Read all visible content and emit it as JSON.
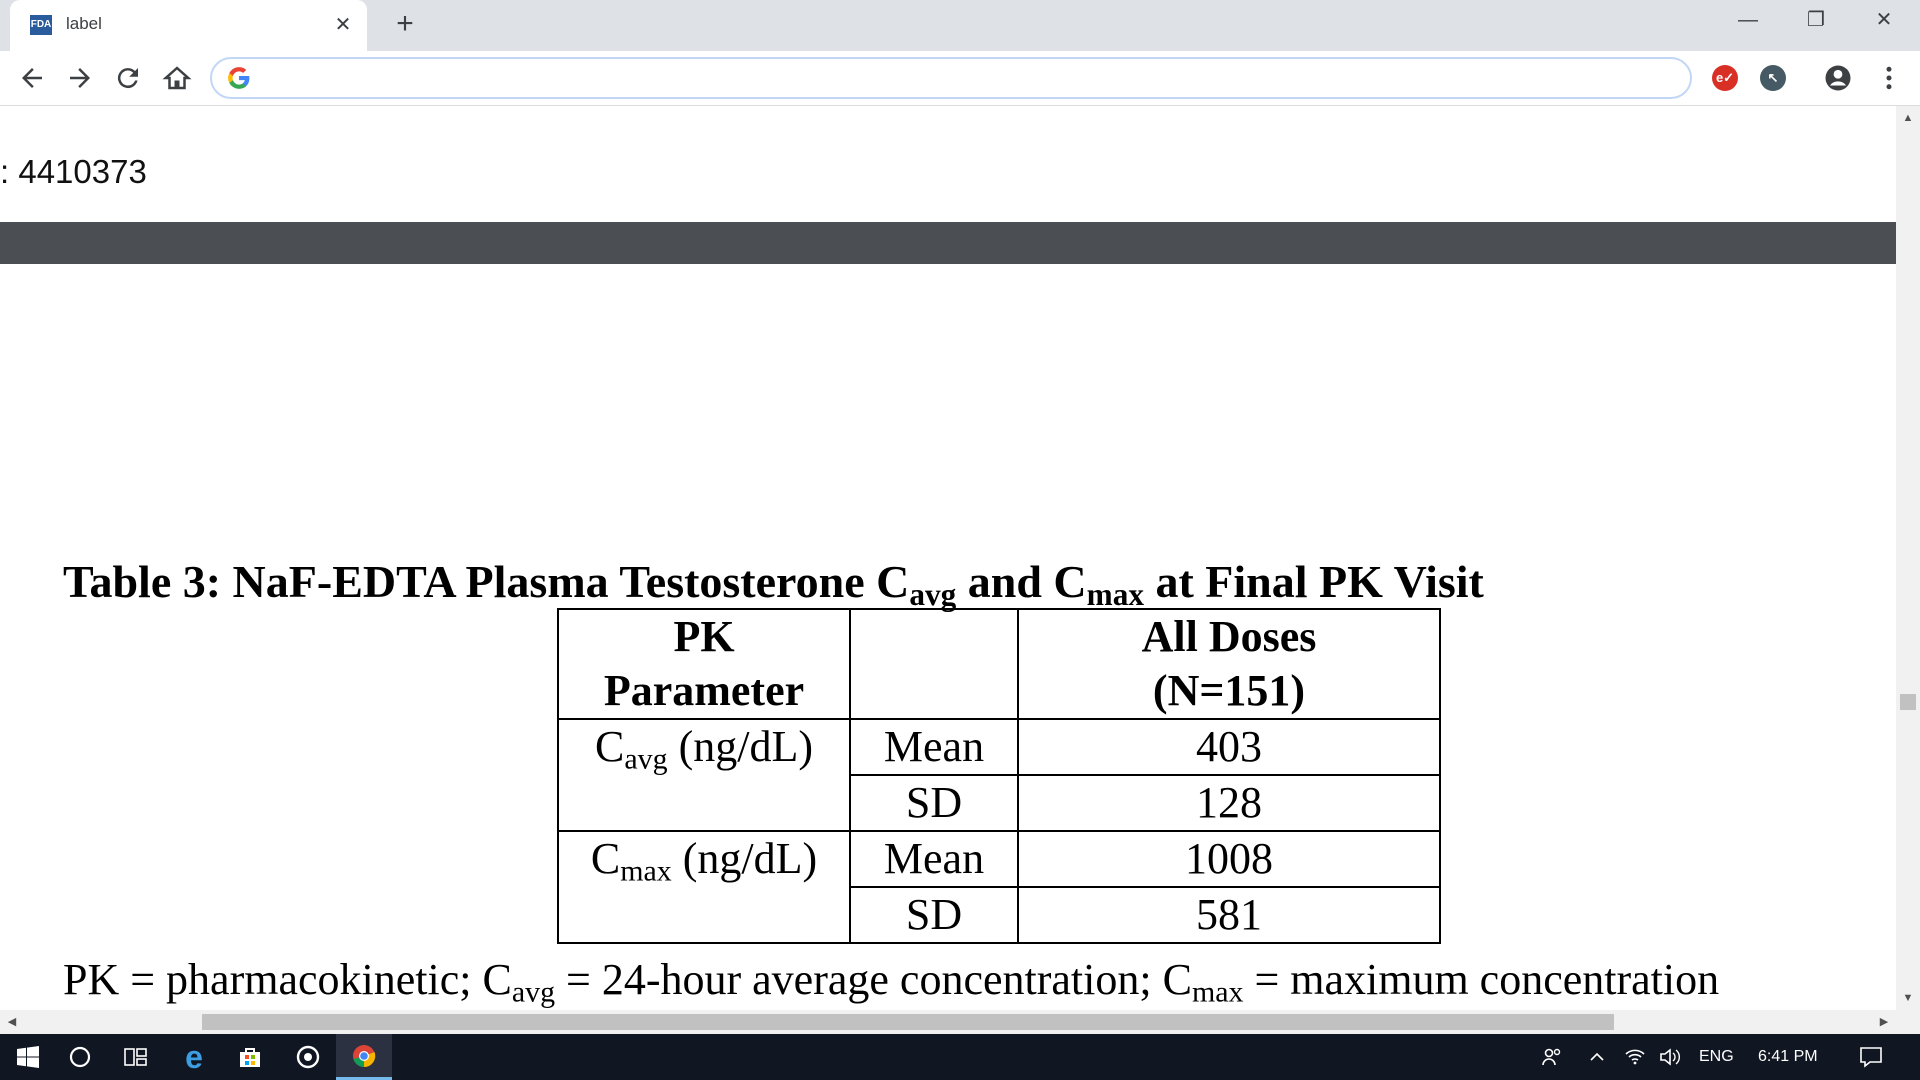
{
  "browser": {
    "tab": {
      "favicon_text": "FDA",
      "title": "label",
      "close_glyph": "✕"
    },
    "new_tab_glyph": "+",
    "window_controls": {
      "minimize": "—",
      "restore": "❐",
      "close": "✕"
    },
    "address_bar": {
      "value": "",
      "placeholder": ""
    },
    "icons": [
      "back-icon",
      "forward-icon",
      "reload-icon",
      "home-icon",
      "google-icon",
      "extension-red-icon",
      "extension-cursor-icon",
      "profile-icon",
      "menu-icon"
    ],
    "extension_red": {
      "glyph": "e✓",
      "color": "#d93025"
    },
    "extension_dark": {
      "glyph": "↖",
      "color": "#455a64"
    }
  },
  "page": {
    "setid_text": ": 4410373",
    "table_caption": {
      "prefix": "Table 3: NaF-EDTA Plasma Testosterone C",
      "sub1": "avg",
      "mid": " and C",
      "sub2": "max",
      "suffix": " at Final PK Visit"
    },
    "table": {
      "header": {
        "col1_line1": "PK",
        "col1_line2": "Parameter",
        "col2": "",
        "col3_line1": "All Doses",
        "col3_line2": "(N=151)"
      },
      "groups": [
        {
          "param_base": "C",
          "param_sub": "avg",
          "param_unit": " (ng/dL)",
          "rows": [
            {
              "stat": "Mean",
              "value": "403"
            },
            {
              "stat": "SD",
              "value": "128"
            }
          ]
        },
        {
          "param_base": "C",
          "param_sub": "max",
          "param_unit": " (ng/dL)",
          "rows": [
            {
              "stat": "Mean",
              "value": "1008"
            },
            {
              "stat": "SD",
              "value": "581"
            }
          ]
        }
      ]
    },
    "footnote": {
      "part1": "PK = pharmacokinetic; C",
      "sub1": "avg",
      "part2": " = 24-hour average concentration; C",
      "sub2": "max",
      "part3": " = maximum concentration"
    }
  },
  "taskbar": {
    "tray_language": "ENG",
    "clock": "6:41 PM"
  }
}
